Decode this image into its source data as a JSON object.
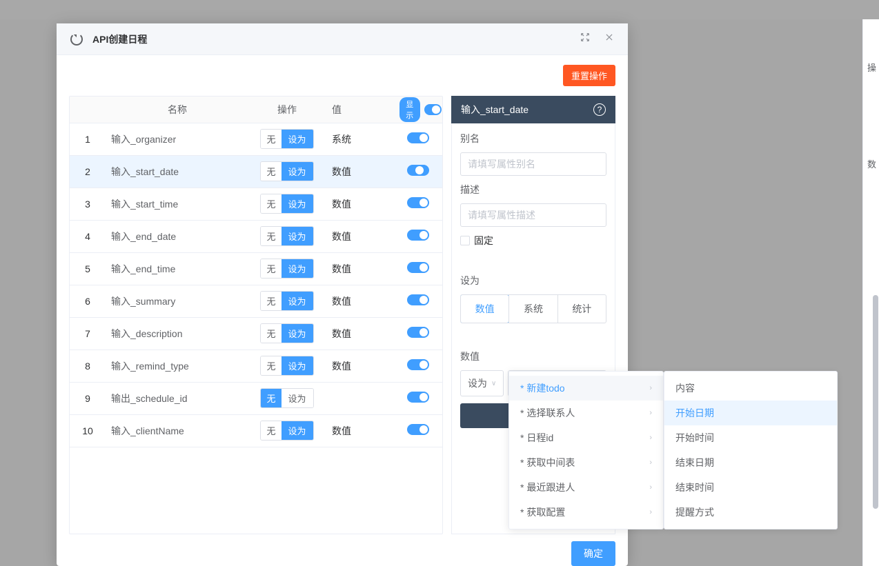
{
  "modal": {
    "title": "API创建日程",
    "reset_button": "重置操作",
    "confirm_button": "确定"
  },
  "table": {
    "headers": {
      "index": "",
      "name": "名称",
      "operation": "操作",
      "value": "值",
      "display": "显示"
    },
    "op_none": "无",
    "op_set": "设为",
    "rows": [
      {
        "idx": "1",
        "name": "输入_organizer",
        "value": "系统",
        "toggle": true,
        "set_active": true
      },
      {
        "idx": "2",
        "name": "输入_start_date",
        "value": "数值",
        "toggle": true,
        "set_active": true,
        "selected": true
      },
      {
        "idx": "3",
        "name": "输入_start_time",
        "value": "数值",
        "toggle": true,
        "set_active": true
      },
      {
        "idx": "4",
        "name": "输入_end_date",
        "value": "数值",
        "toggle": true,
        "set_active": true
      },
      {
        "idx": "5",
        "name": "输入_end_time",
        "value": "数值",
        "toggle": true,
        "set_active": true
      },
      {
        "idx": "6",
        "name": "输入_summary",
        "value": "数值",
        "toggle": true,
        "set_active": true
      },
      {
        "idx": "7",
        "name": "输入_description",
        "value": "数值",
        "toggle": true,
        "set_active": true
      },
      {
        "idx": "8",
        "name": "输入_remind_type",
        "value": "数值",
        "toggle": true,
        "set_active": true
      },
      {
        "idx": "9",
        "name": "输出_schedule_id",
        "value": "",
        "toggle": true,
        "set_active": false
      },
      {
        "idx": "10",
        "name": "输入_clientName",
        "value": "数值",
        "toggle": true,
        "set_active": true
      }
    ]
  },
  "sidepanel": {
    "title": "输入_start_date",
    "alias_label": "别名",
    "alias_placeholder": "请填写属性别名",
    "desc_label": "描述",
    "desc_placeholder": "请填写属性描述",
    "fixed_label": "固定",
    "setas_label": "设为",
    "tabs": {
      "numeric": "数值",
      "system": "系统",
      "stat": "统计"
    },
    "value_label": "数值",
    "select_setas": "设为",
    "select_value": "* 新建todo / 开始日期"
  },
  "dropdown": {
    "level1": [
      {
        "label": "* 新建todo",
        "active": true
      },
      {
        "label": "* 选择联系人"
      },
      {
        "label": "* 日程id"
      },
      {
        "label": "* 获取中间表"
      },
      {
        "label": "* 最近跟进人"
      },
      {
        "label": "* 获取配置"
      }
    ],
    "level2": [
      {
        "label": "内容"
      },
      {
        "label": "开始日期",
        "selected": true
      },
      {
        "label": "开始时间"
      },
      {
        "label": "结束日期"
      },
      {
        "label": "结束时间"
      },
      {
        "label": "提醒方式"
      }
    ]
  },
  "right_edge": {
    "top": "操",
    "mid": "数"
  },
  "colors": {
    "primary": "#409eff",
    "danger": "#ff5722",
    "panel_header": "#3a4b5f"
  }
}
